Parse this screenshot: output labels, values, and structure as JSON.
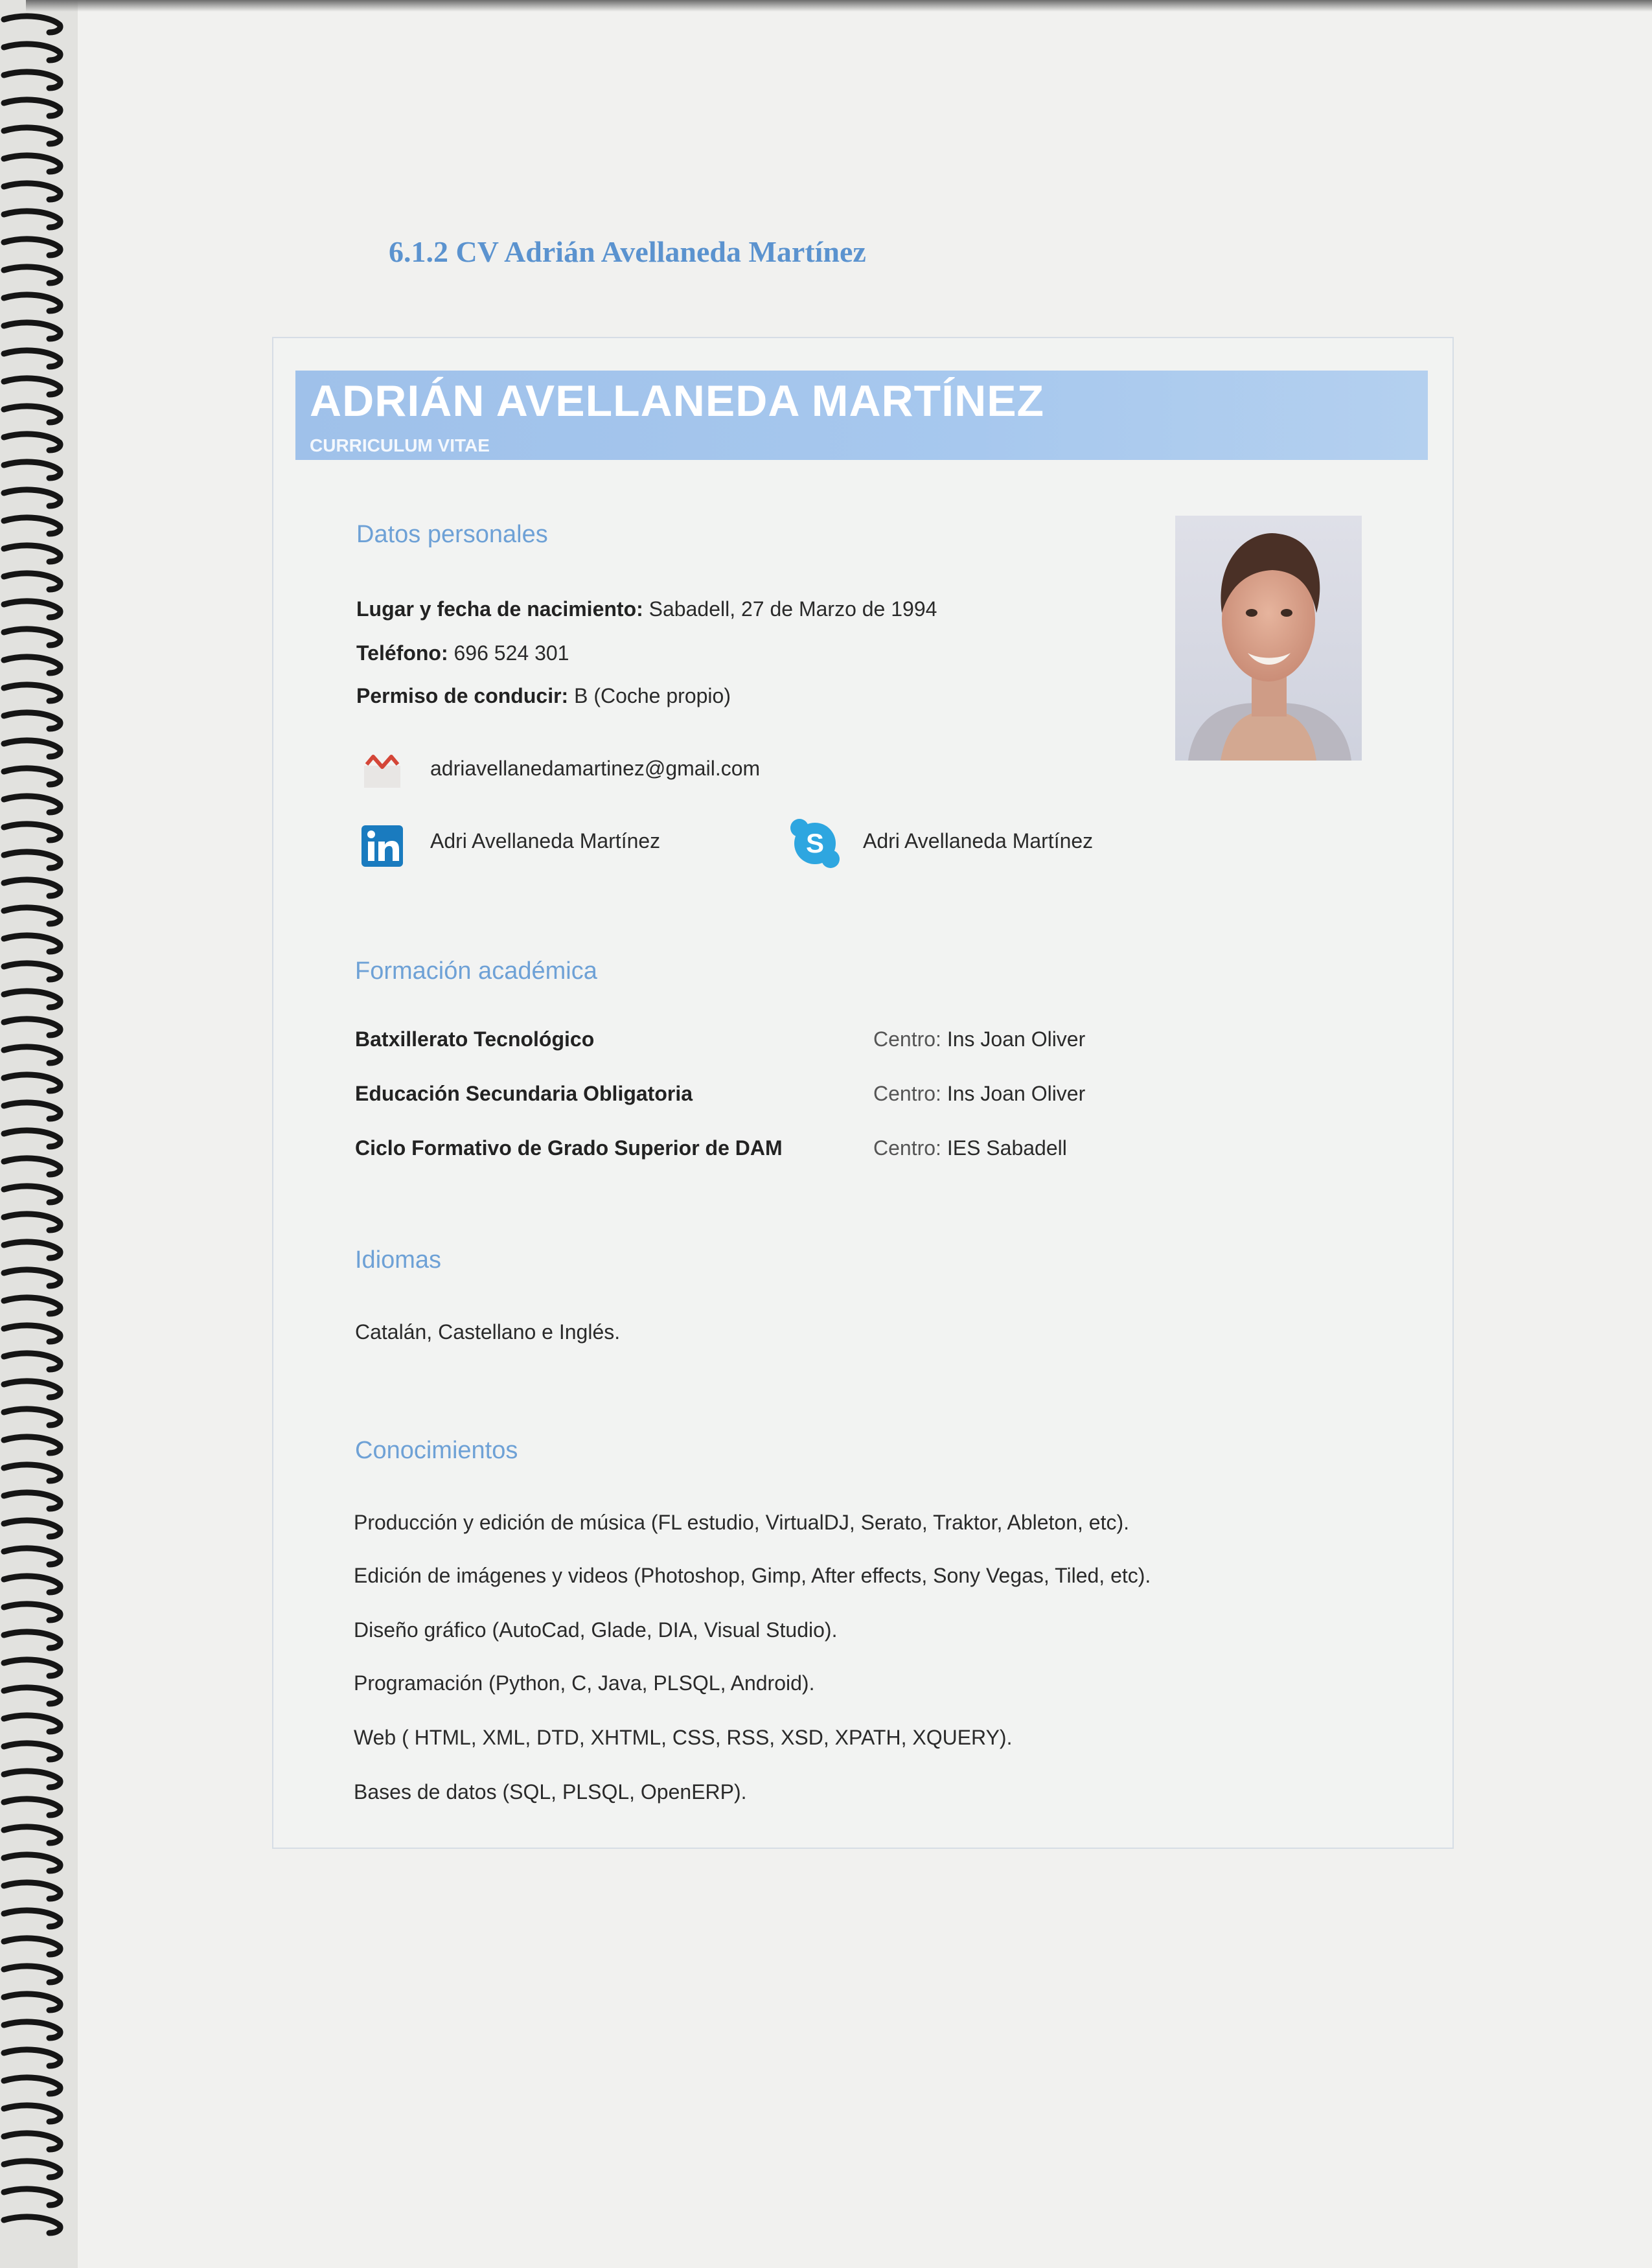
{
  "section_heading": "6.1.2 CV Adrián Avellaneda Martínez",
  "header": {
    "name": "ADRIÁN AVELLANEDA MARTÍNEZ",
    "subtitle": "CURRICULUM VITAE"
  },
  "personal": {
    "heading": "Datos personales",
    "birth_label": "Lugar y fecha de nacimiento:",
    "birth_value": "Sabadell, 27 de Marzo de 1994",
    "phone_label": "Teléfono:",
    "phone_value": "696 524 301",
    "license_label": "Permiso de conducir:",
    "license_value": "B (Coche propio)",
    "email": "adriavellanedamartinez@gmail.com",
    "linkedin": "Adri Avellaneda Martínez",
    "skype": "Adri Avellaneda Martínez"
  },
  "education": {
    "heading": "Formación académica",
    "centro_label": "Centro:",
    "items": [
      {
        "title": "Batxillerato Tecnológico",
        "center": "Ins Joan Oliver"
      },
      {
        "title": "Educación Secundaria Obligatoria",
        "center": "Ins Joan Oliver"
      },
      {
        "title": "Ciclo Formativo de Grado Superior de DAM",
        "center": "IES Sabadell"
      }
    ]
  },
  "languages": {
    "heading": "Idiomas",
    "text": "Catalán, Castellano e Inglés."
  },
  "skills": {
    "heading": "Conocimientos",
    "items": [
      "Producción y edición de música (FL estudio, VirtualDJ, Serato, Traktor, Ableton, etc).",
      "Edición de imágenes y videos (Photoshop, Gimp, After effects, Sony Vegas, Tiled, etc).",
      "Diseño gráfico (AutoCad, Glade, DIA, Visual Studio).",
      "Programación (Python, C, Java, PLSQL, Android).",
      "Web ( HTML, XML, DTD, XHTML, CSS, RSS, XSD, XPATH, XQUERY).",
      "Bases de datos (SQL, PLSQL, OpenERP)."
    ]
  },
  "colors": {
    "accent": "#6ea1d6",
    "header_band": "#a7c8ee",
    "linkedin": "#1a7bbf",
    "skype": "#2ea6e0",
    "gmail": "#d44638"
  }
}
